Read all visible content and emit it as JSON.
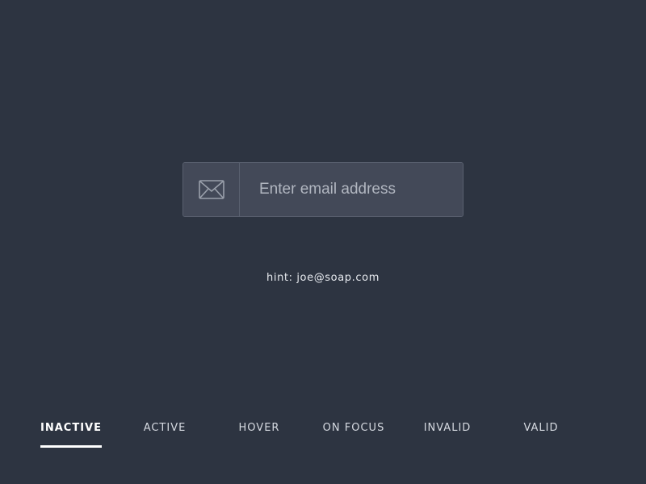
{
  "email": {
    "placeholder": "Enter email address",
    "value": "",
    "icon": "envelope-icon"
  },
  "hint": {
    "text": "hint: joe@soap.com"
  },
  "tabs": [
    {
      "label": "INACTIVE",
      "selected": true
    },
    {
      "label": "ACTIVE",
      "selected": false
    },
    {
      "label": "HOVER",
      "selected": false
    },
    {
      "label": "ON FOCUS",
      "selected": false
    },
    {
      "label": "INVALID",
      "selected": false
    },
    {
      "label": "VALID",
      "selected": false
    }
  ],
  "colors": {
    "background": "#2d3441",
    "input_background": "#434958",
    "input_border": "#59606f",
    "text": "#e6e9ee",
    "active_tab": "#ffffff"
  }
}
